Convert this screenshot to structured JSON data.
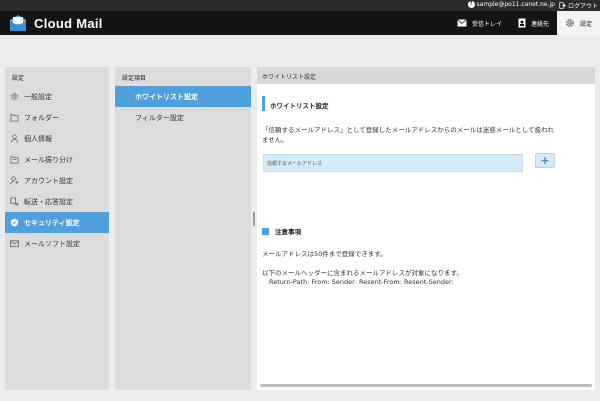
{
  "topbar": {
    "account": "sample@po11.canet.ne.jp",
    "logout": "ログアウト"
  },
  "header": {
    "app_title": "Cloud Mail",
    "nav": [
      {
        "label": "受信トレイ",
        "icon": "mail-icon"
      },
      {
        "label": "連絡先",
        "icon": "address-book-icon"
      },
      {
        "label": "設定",
        "icon": "gear-icon",
        "active": true
      }
    ]
  },
  "settings_menu": {
    "heading": "設定",
    "items": [
      {
        "label": "一般設定",
        "icon": "gear-icon"
      },
      {
        "label": "フォルダー",
        "icon": "folder-icon"
      },
      {
        "label": "個人情報",
        "icon": "person-icon"
      },
      {
        "label": "メール振り分け",
        "icon": "folder-filter-icon"
      },
      {
        "label": "アカウント設定",
        "icon": "account-icon"
      },
      {
        "label": "転送・応答設定",
        "icon": "forward-icon"
      },
      {
        "label": "セキュリティ設定",
        "icon": "shield-icon",
        "active": true
      },
      {
        "label": "メールソフト設定",
        "icon": "mail-client-icon"
      }
    ]
  },
  "sub_menu": {
    "heading": "設定項目",
    "items": [
      {
        "label": "ホワイトリスト設定",
        "active": true
      },
      {
        "label": "フィルター設定"
      }
    ]
  },
  "main": {
    "titlebar": "ホワイトリスト設定",
    "section_title": "ホワイトリスト設定",
    "description_line1": "「信頼するメールアドレス」として登録したメールアドレスからのメールは迷惑メールとして扱われ",
    "description_line2": "ません。",
    "input_placeholder": "信頼するメールアドレス",
    "add_label": "+",
    "note_title": "注意事項",
    "note1": "メールアドレスは50件まで登録できます。",
    "note2": "以下のメールヘッダーに含まれるメールアドレスが対象になります。",
    "note3": "Return-Path: From: Sender: Resent-From: Resent-Sender:"
  },
  "colors": {
    "accent": "#4fa0dd",
    "header": "#141414"
  }
}
